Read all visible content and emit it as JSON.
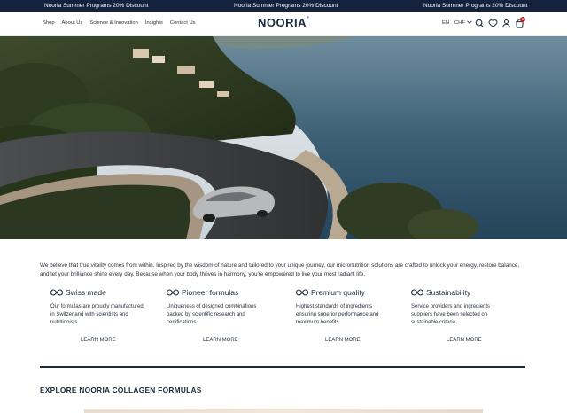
{
  "promo": {
    "messages": [
      "Nooria Summer Programs 20% Discount",
      "Nooria Summer Programs 20% Discount",
      "Nooria Summer Programs 20% Discount"
    ]
  },
  "header": {
    "nav": [
      "Shop",
      "About Us",
      "Science & Innovation",
      "Insights",
      "Contact Us"
    ],
    "logo": "NOORIA",
    "logo_mark": "®",
    "language": "EN",
    "currency": "CHF",
    "cart_count": "0",
    "icons": [
      "search-icon",
      "heart-icon",
      "user-icon",
      "bag-icon",
      "chevron-down-icon"
    ]
  },
  "hero": {
    "image": "coastal-road-convertible"
  },
  "intro": {
    "text": "We believe that true vitality comes from within. Inspired by the wisdom of nature and tailored to your unique journey, our micronutrition solutions are crafted to unlock your energy, restore balance, and let your brilliance shine every day. Because when your body thrives in harmony, you're empowered to live your most radiant life."
  },
  "features": [
    {
      "title": "Swiss made",
      "description": "Our formulas are proudly manufactured in Switzerland with scientists and nutritionists",
      "cta": "LEARN MORE"
    },
    {
      "title": "Pioneer formulas",
      "description": "Uniqueness of designed combinations backed by scientific research and certifications",
      "cta": "LEARN MORE"
    },
    {
      "title": "Premium quality",
      "description": "Highest standards of ingredients ensuring superior performance and maximum benefits",
      "cta": "LEARN MORE"
    },
    {
      "title": "Sustainability",
      "description": "Service providers and ingredients suppliers have been selected on sustainable criteria",
      "cta": "LEARN MORE"
    }
  ],
  "section": {
    "title": "EXPLORE NOORIA COLLAGEN FORMULAS"
  },
  "colors": {
    "promo_bg": "#14223d",
    "text": "#1c2a3a",
    "badge": "#c62828"
  }
}
